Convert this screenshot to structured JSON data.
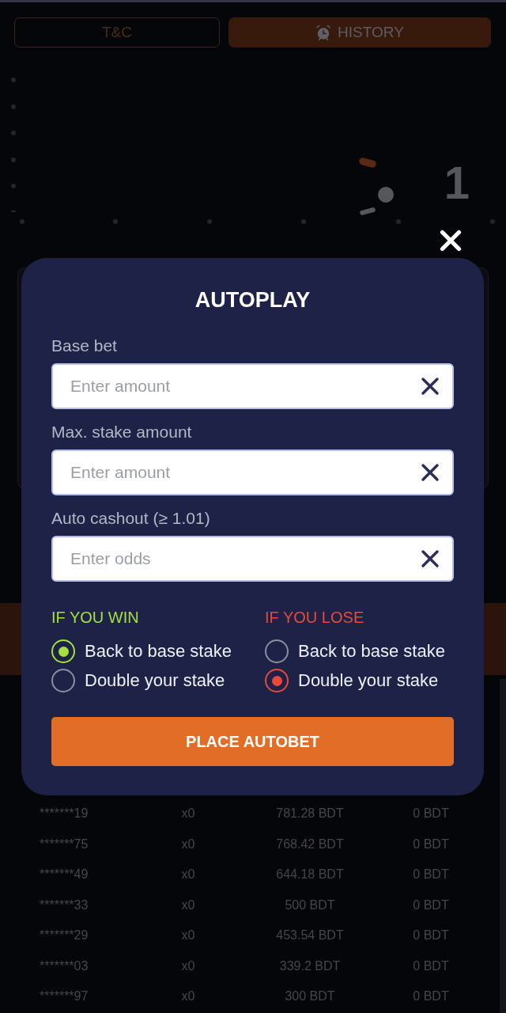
{
  "tabs": [
    {
      "label": "T&C",
      "kind": "outline"
    },
    {
      "label": "HISTORY",
      "kind": "filled"
    }
  ],
  "round": {
    "multiplier": "1"
  },
  "autoplay": {
    "title": "AUTOPLAY",
    "fields": [
      {
        "label": "Base bet",
        "placeholder": "Enter amount"
      },
      {
        "label": "Max. stake amount",
        "placeholder": "Enter amount"
      },
      {
        "label": "Auto cashout (≥ 1.01)",
        "placeholder": "Enter odds"
      }
    ],
    "outcomes": [
      {
        "title": "IF YOU WIN",
        "color": "#a4e13f",
        "options": [
          {
            "label": "Back to base stake",
            "selected": true
          },
          {
            "label": "Double your stake",
            "selected": false
          }
        ]
      },
      {
        "title": "IF YOU LOSE",
        "color": "#e8493c",
        "options": [
          {
            "label": "Back to base stake",
            "selected": false
          },
          {
            "label": "Double your stake",
            "selected": true
          }
        ]
      }
    ],
    "submit": "PLACE AUTOBET"
  },
  "bets": [
    [
      "*******19",
      "x0",
      "781.28 BDT",
      "0 BDT"
    ],
    [
      "*******75",
      "x0",
      "768.42 BDT",
      "0 BDT"
    ],
    [
      "*******49",
      "x0",
      "644.18 BDT",
      "0 BDT"
    ],
    [
      "*******33",
      "x0",
      "500 BDT",
      "0 BDT"
    ],
    [
      "*******29",
      "x0",
      "453.54 BDT",
      "0 BDT"
    ],
    [
      "*******03",
      "x0",
      "339.2 BDT",
      "0 BDT"
    ],
    [
      "*******97",
      "x0",
      "300 BDT",
      "0 BDT"
    ]
  ]
}
